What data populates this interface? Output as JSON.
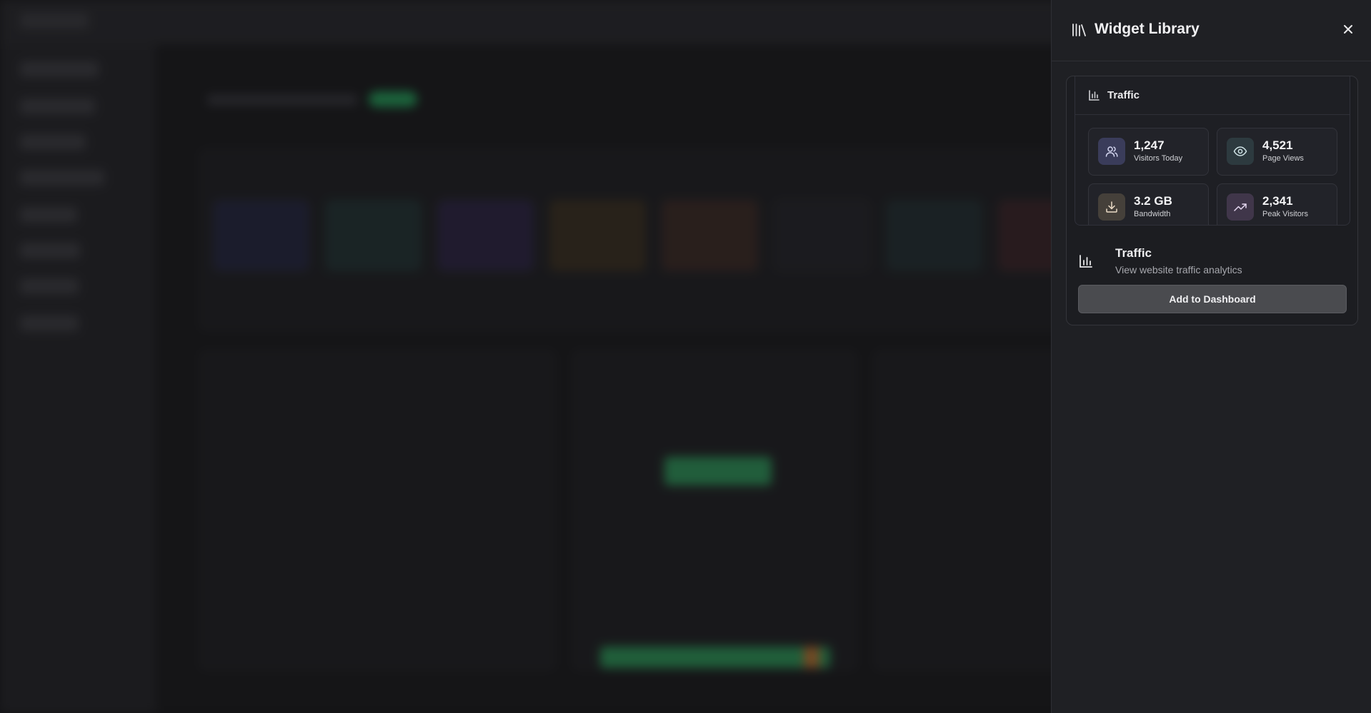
{
  "drawer": {
    "title": "Widget Library",
    "header_icon": "library-icon",
    "close_icon": "close-icon"
  },
  "widget": {
    "preview": {
      "title": "Traffic",
      "icon": "bar-chart-icon",
      "stats": [
        {
          "value": "1,247",
          "label": "Visitors Today",
          "icon": "users-icon",
          "accent": "#3a3c5a"
        },
        {
          "value": "4,521",
          "label": "Page Views",
          "icon": "eye-icon",
          "accent": "#2d3a3f"
        },
        {
          "value": "3.2 GB",
          "label": "Bandwidth",
          "icon": "download-icon",
          "accent": "#45403a"
        },
        {
          "value": "2,341",
          "label": "Peak Visitors",
          "icon": "trending-up-icon",
          "accent": "#40364a"
        }
      ]
    },
    "info": {
      "title": "Traffic",
      "description": "View website traffic analytics",
      "icon": "bar-chart-icon"
    },
    "add_button_label": "Add to Dashboard"
  },
  "colors": {
    "drawer_bg": "#1f2024",
    "button_bg": "#4a4b4f",
    "backdrop_accent_green": "#22a35a"
  }
}
